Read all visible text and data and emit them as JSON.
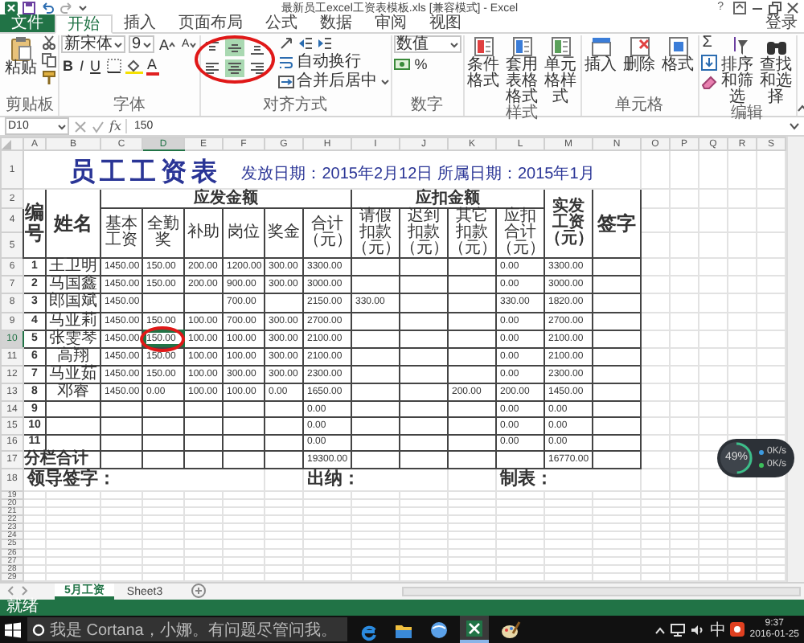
{
  "window": {
    "title": "最新员工excel工资表模板.xls [兼容模式] - Excel",
    "help": "?"
  },
  "tabs": [
    {
      "label": "文件",
      "kind": "file",
      "selected": false
    },
    {
      "label": "开始",
      "kind": "tab",
      "selected": true
    },
    {
      "label": "插入",
      "kind": "tab",
      "selected": false
    },
    {
      "label": "页面布局",
      "kind": "tab",
      "selected": false
    },
    {
      "label": "公式",
      "kind": "tab",
      "selected": false
    },
    {
      "label": "数据",
      "kind": "tab",
      "selected": false
    },
    {
      "label": "审阅",
      "kind": "tab",
      "selected": false
    },
    {
      "label": "视图",
      "kind": "tab",
      "selected": false
    }
  ],
  "account": "登录",
  "ribbon": {
    "clipboard": {
      "paste": "粘贴",
      "label": "剪贴板"
    },
    "font": {
      "family": "新宋体",
      "size": "9",
      "grow": "A",
      "shrink": "A",
      "styles": [
        "B",
        "I",
        "U"
      ],
      "text_color_button": "A",
      "label": "字体"
    },
    "alignment": {
      "annotated": true,
      "vertical": [
        {
          "kind": "top",
          "selected": false
        },
        {
          "kind": "middle",
          "selected": true
        },
        {
          "kind": "bottom",
          "selected": false
        }
      ],
      "horizontal": [
        {
          "kind": "left",
          "selected": false
        },
        {
          "kind": "center",
          "selected": true
        },
        {
          "kind": "right",
          "selected": false
        }
      ],
      "wrap": "自动换行",
      "merge": "合并后居中",
      "label": "对齐方式"
    },
    "number": {
      "format": "数值",
      "percent": "%",
      "label": "数字"
    },
    "styles": {
      "buttons": [
        "条件格式",
        "套用表格格式",
        "单元格样式"
      ],
      "label": "样式"
    },
    "cells": {
      "buttons": [
        "插入",
        "删除",
        "格式"
      ],
      "label": "单元格"
    },
    "editing": {
      "sum": "Σ",
      "buttons": [
        "排序和筛选",
        "查找和选择"
      ],
      "label": "编辑"
    }
  },
  "formula_bar": {
    "cell": "D10",
    "fx": "fx",
    "value": "150"
  },
  "sheet": {
    "columns": [
      {
        "label": "A",
        "selected": false
      },
      {
        "label": "B",
        "selected": false
      },
      {
        "label": "C",
        "selected": false
      },
      {
        "label": "D",
        "selected": true
      },
      {
        "label": "E",
        "selected": false
      },
      {
        "label": "F",
        "selected": false
      },
      {
        "label": "G",
        "selected": false
      },
      {
        "label": "H",
        "selected": false
      },
      {
        "label": "I",
        "selected": false
      },
      {
        "label": "J",
        "selected": false
      },
      {
        "label": "K",
        "selected": false
      },
      {
        "label": "L",
        "selected": false
      },
      {
        "label": "M",
        "selected": false
      },
      {
        "label": "N",
        "selected": false
      },
      {
        "label": "O",
        "selected": false
      },
      {
        "label": "P",
        "selected": false
      },
      {
        "label": "Q",
        "selected": false
      },
      {
        "label": "R",
        "selected": false
      },
      {
        "label": "S",
        "selected": false
      }
    ],
    "selection_annotated": true,
    "title_row": "1",
    "title": "员工工资表",
    "dates": "发放日期：2015年2月12日  所属日期：2015年1月",
    "header_rows": [
      "2",
      "4",
      "5"
    ],
    "header": {
      "no": "编号",
      "name": "姓名",
      "earned": "应发金额",
      "earned_cols": [
        "基本工资",
        "全勤奖",
        "补助",
        "岗位",
        "奖金",
        "合计（元）"
      ],
      "deducted": "应扣金额",
      "deducted_cols": [
        "请假扣款（元）",
        "迟到扣款（元）",
        "其它扣款（元）",
        "应扣合计（元）"
      ],
      "net": "实发工资（元）",
      "sign": "签字"
    },
    "rows": [
      {
        "row": "6",
        "selected": false,
        "cells": [
          "1",
          "王卫明",
          "1450.00",
          "150.00",
          "200.00",
          "1200.00",
          "300.00",
          "3300.00",
          null,
          null,
          null,
          "0.00",
          "3300.00",
          null
        ]
      },
      {
        "row": "7",
        "selected": false,
        "cells": [
          "2",
          "马国鑫",
          "1450.00",
          "150.00",
          "200.00",
          "900.00",
          "300.00",
          "3000.00",
          null,
          null,
          null,
          "0.00",
          "3000.00",
          null
        ]
      },
      {
        "row": "8",
        "selected": false,
        "cells": [
          "3",
          "郎国斌",
          "1450.00",
          null,
          null,
          "700.00",
          null,
          "2150.00",
          "330.00",
          null,
          null,
          "330.00",
          "1820.00",
          null
        ]
      },
      {
        "row": "9",
        "selected": false,
        "cells": [
          "4",
          "马亚莉",
          "1450.00",
          "150.00",
          "100.00",
          "700.00",
          "300.00",
          "2700.00",
          null,
          null,
          null,
          "0.00",
          "2700.00",
          null
        ]
      },
      {
        "row": "10",
        "selected": true,
        "cells": [
          "5",
          "张雯琴",
          "1450.00",
          "150.00",
          "100.00",
          "100.00",
          "300.00",
          "2100.00",
          null,
          null,
          null,
          "0.00",
          "2100.00",
          null
        ]
      },
      {
        "row": "11",
        "selected": false,
        "cells": [
          "6",
          "高翔",
          "1450.00",
          "150.00",
          "100.00",
          "100.00",
          "300.00",
          "2100.00",
          null,
          null,
          null,
          "0.00",
          "2100.00",
          null
        ]
      },
      {
        "row": "12",
        "selected": false,
        "cells": [
          "7",
          "马亚茹",
          "1450.00",
          "150.00",
          "100.00",
          "300.00",
          "300.00",
          "2300.00",
          null,
          null,
          null,
          "0.00",
          "2300.00",
          null
        ]
      },
      {
        "row": "13",
        "selected": false,
        "cells": [
          "8",
          "邓睿",
          "1450.00",
          "0.00",
          "100.00",
          "100.00",
          "0.00",
          "1650.00",
          null,
          null,
          "200.00",
          "200.00",
          "1450.00",
          null
        ]
      },
      {
        "row": "14",
        "selected": false,
        "cells": [
          "9",
          null,
          null,
          null,
          null,
          null,
          null,
          "0.00",
          null,
          null,
          null,
          "0.00",
          "0.00",
          null
        ]
      },
      {
        "row": "15",
        "selected": false,
        "cells": [
          "10",
          null,
          null,
          null,
          null,
          null,
          null,
          "0.00",
          null,
          null,
          null,
          "0.00",
          "0.00",
          null
        ]
      },
      {
        "row": "16",
        "selected": false,
        "cells": [
          "11",
          null,
          null,
          null,
          null,
          null,
          null,
          "0.00",
          null,
          null,
          null,
          "0.00",
          "0.00",
          null
        ]
      }
    ],
    "total": {
      "row": "17",
      "cells": [
        "分栏合计",
        null,
        null,
        null,
        null,
        null,
        null,
        "19300.00",
        null,
        null,
        null,
        null,
        "16770.00",
        null
      ]
    },
    "signature": {
      "row": "18",
      "leader": "领导签字：",
      "cashier": "出纳：",
      "maker": "制表："
    },
    "empty_rows": [
      "19",
      "20",
      "21",
      "22",
      "23",
      "24",
      "25",
      "26",
      "27",
      "28",
      "29"
    ]
  },
  "widget": {
    "percent": "49%",
    "level": 0.49,
    "rates": [
      {
        "text": "0K/s",
        "color": "#3d9be0"
      },
      {
        "text": "0K/s",
        "color": "#3cbf5a"
      }
    ]
  },
  "sheet_tabs": [
    {
      "label": "5月工资",
      "selected": true
    },
    {
      "label": "Sheet3",
      "selected": false
    }
  ],
  "status": "就绪",
  "taskbar": {
    "search": "我是 Cortana，小娜。有问题尽管问我。",
    "apps": [
      {
        "kind": "edge",
        "selected": false
      },
      {
        "kind": "explorer",
        "selected": false
      },
      {
        "kind": "browser",
        "selected": false
      },
      {
        "kind": "excel",
        "selected": true
      },
      {
        "kind": "paint",
        "selected": false
      }
    ],
    "ime": "中",
    "time": "9:37",
    "date": "2016-01-25"
  }
}
